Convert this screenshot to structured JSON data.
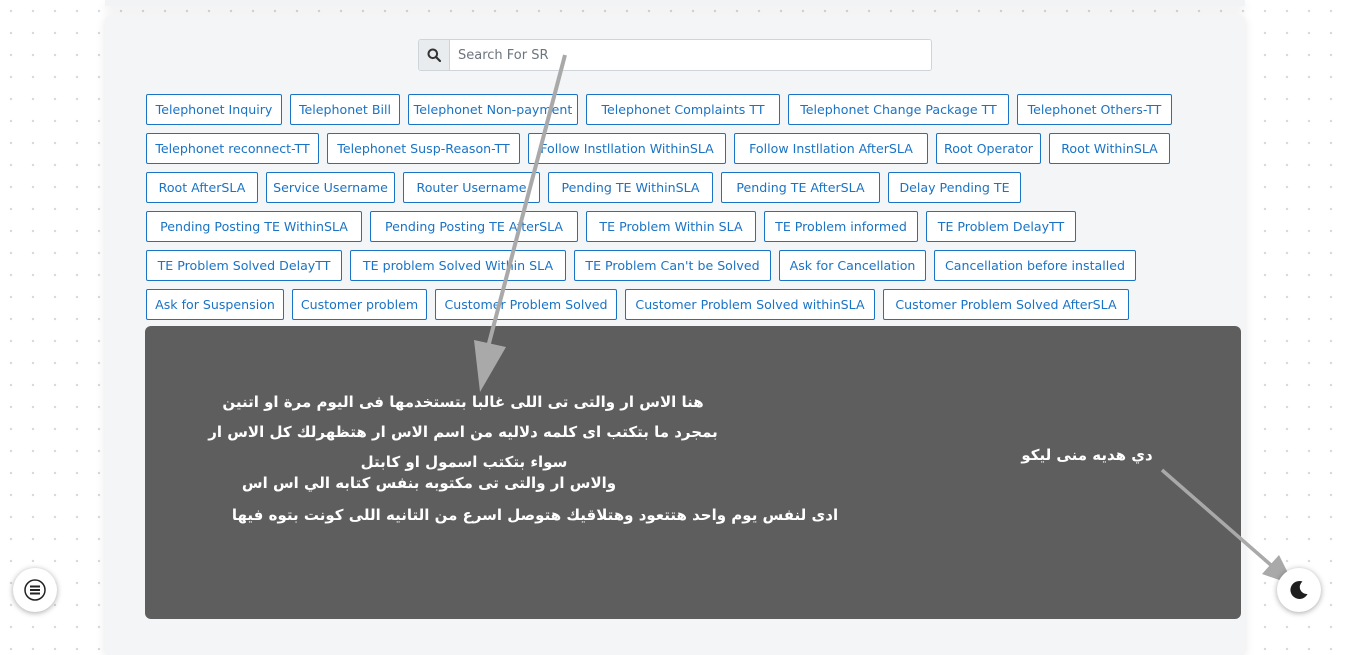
{
  "search": {
    "placeholder": "Search For SR",
    "value": ""
  },
  "tag_rows": [
    [
      "Telephonet Inquiry",
      "Telephonet Bill",
      "Telephonet Non-payment",
      "Telephonet Complaints TT",
      "Telephonet Change Package TT",
      "Telephonet Others-TT"
    ],
    [
      "Telephonet reconnect-TT",
      "Telephonet Susp-Reason-TT",
      "Follow Instllation WithinSLA",
      "Follow Instllation AfterSLA",
      "Root Operator",
      "Root WithinSLA"
    ],
    [
      "Root AfterSLA",
      "Service Username",
      "Router Username",
      "Pending TE WithinSLA",
      "Pending TE AfterSLA",
      "Delay Pending TE"
    ],
    [
      "Pending Posting TE WithinSLA",
      "Pending Posting TE AfterSLA",
      "TE Problem Within SLA",
      "TE Problem informed",
      "TE Problem DelayTT"
    ],
    [
      "TE Problem Solved DelayTT",
      "TE problem Solved Within SLA",
      "TE Problem Can't be Solved",
      "Ask for Cancellation",
      "Cancellation before installed"
    ],
    [
      "Ask for Suspension",
      "Customer problem",
      "Customer Problem Solved",
      "Customer Problem Solved withinSLA",
      "Customer Problem Solved AfterSLA"
    ]
  ],
  "overlay": {
    "lines": [
      "هنا الاس ار والتى تى اللى غالبا بتستخدمها فى اليوم مرة او اتنين",
      "بمجرد ما بتكتب اى كلمه دلاليه من اسم الاس ار هتظهرلك كل الاس ار",
      "سواء بتكتب اسمول او كابتل",
      "والاس ار والتى تى مكتوبه بنفس كتابه الي اس اس",
      "ادى لنفس يوم واحد هتتعود وهتلاقيك هتوصل اسرع من التانيه اللى كونت بتوه فيها"
    ],
    "gift_text": "دي هديه منى ليكو"
  },
  "icons": {
    "search": "search-icon",
    "menu": "menu-icon",
    "theme": "moon-icon"
  },
  "colors": {
    "tag_accent": "#1a73c5",
    "overlay_bg": "#5e5e5e",
    "arrow": "#a9a9a9"
  }
}
